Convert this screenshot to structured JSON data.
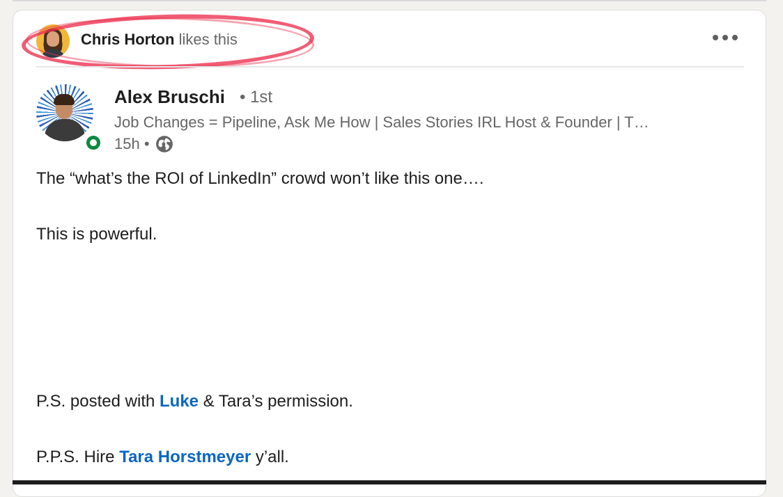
{
  "activity": {
    "actor_name": "Chris Horton",
    "action_text": " likes this"
  },
  "post": {
    "author": {
      "name": "Alex Bruschi",
      "degree": "• 1st",
      "headline": "Job Changes = Pipeline, Ask Me How | Sales Stories IRL Host & Founder | T…",
      "time": "15h •",
      "presence": "online"
    },
    "body": {
      "line1": "The “what’s the ROI of LinkedIn” crowd won’t like this one….",
      "line2": "This is powerful.",
      "line3_prefix": "P.S. posted with ",
      "line3_mention": "Luke",
      "line3_suffix": " & Tara’s permission.",
      "line4_prefix": "P.P.S. Hire ",
      "line4_mention": "Tara Horstmeyer",
      "line4_suffix": " y’all."
    }
  },
  "icons": {
    "more": "more-horizontal-icon",
    "globe": "globe-icon",
    "presence": "online-status-icon"
  },
  "colors": {
    "mention": "#0a66c2",
    "presence_green": "#0a8a3e",
    "highlight_red": "#ec304e"
  }
}
